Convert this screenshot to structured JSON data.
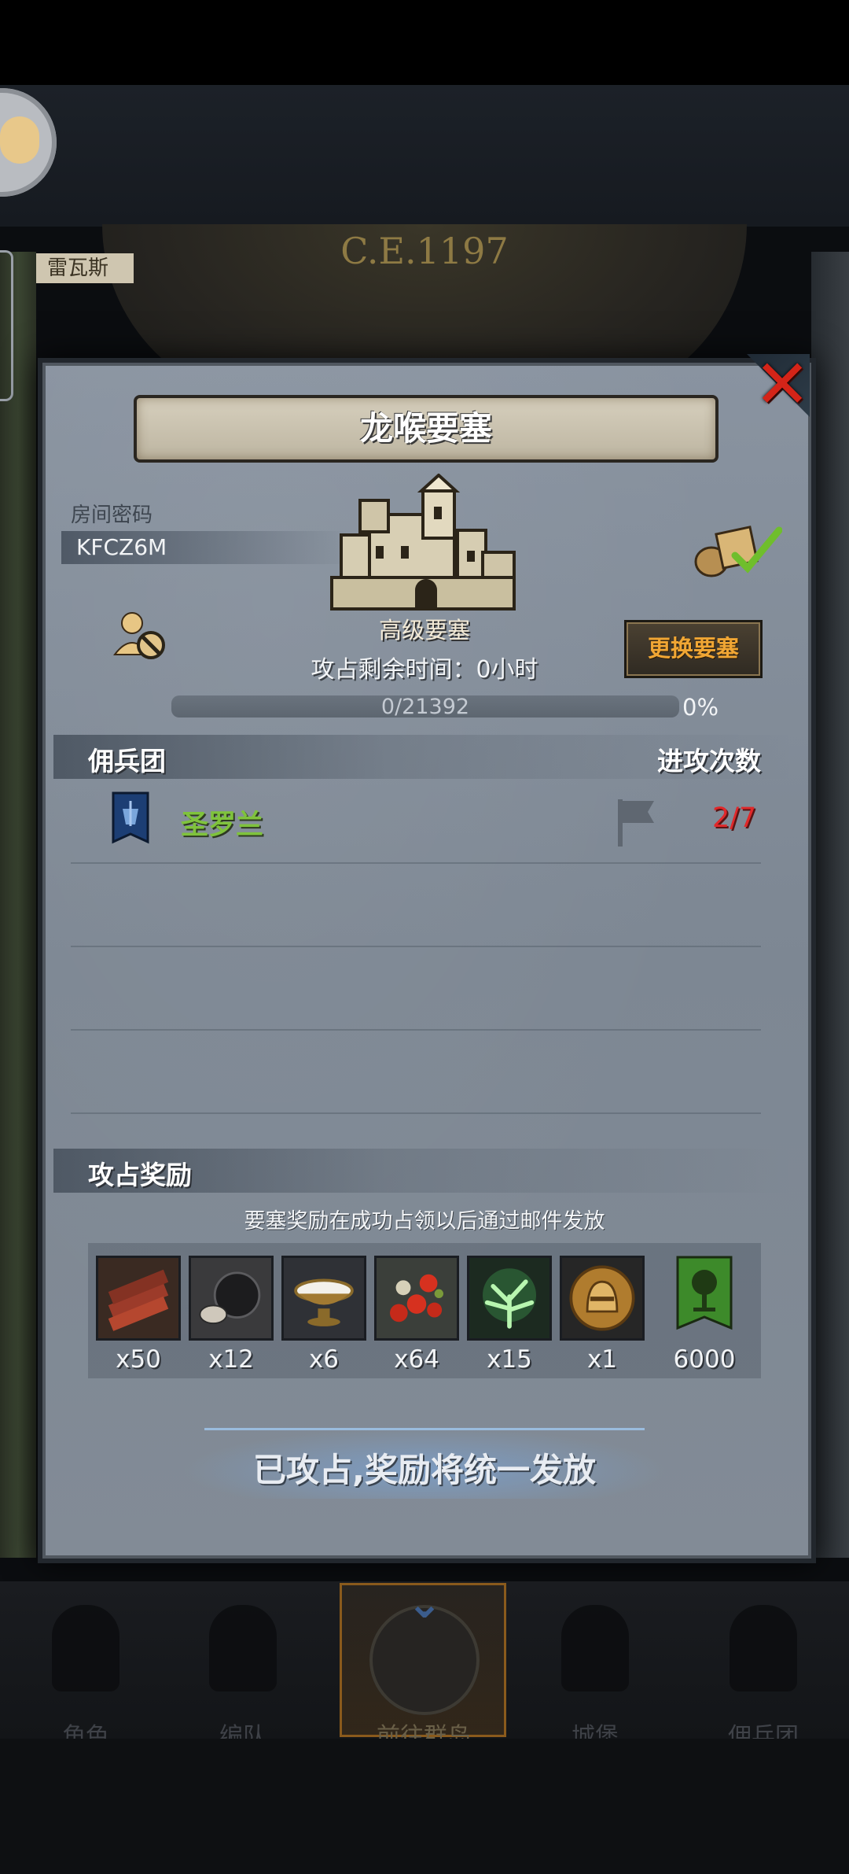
{
  "header": {
    "era": "C.E.1197",
    "map_location_tag": "雷瓦斯"
  },
  "dialog": {
    "title": "龙喉要塞",
    "room_code_label": "房间密码",
    "room_code_value": "KFCZ6M",
    "fortress_grade": "高级要塞",
    "change_button": "更换要塞",
    "remaining_time": "攻占剩余时间：0小时",
    "progress": {
      "current": 0,
      "total": 21392,
      "text": "0/21392",
      "percent": "0%"
    },
    "mercenary_section": {
      "title": "佣兵团",
      "column_right": "进攻次数",
      "rows": [
        {
          "name": "圣罗兰",
          "attacks": "2/7"
        }
      ]
    },
    "reward_section": {
      "title": "攻占奖励",
      "note": "要塞奖励在成功占领以后通过邮件发放",
      "items": [
        {
          "icon": "wood-planks-icon",
          "qty": "x50"
        },
        {
          "icon": "truffle-icon",
          "qty": "x12"
        },
        {
          "icon": "milk-bowl-icon",
          "qty": "x6"
        },
        {
          "icon": "berries-icon",
          "qty": "x64"
        },
        {
          "icon": "glowing-tree-icon",
          "qty": "x15"
        },
        {
          "icon": "knight-medal-icon",
          "qty": "x1"
        },
        {
          "icon": "green-banner-icon",
          "qty": "6000"
        }
      ]
    },
    "status": "已攻占,奖励将统一发放"
  },
  "bottom_nav": {
    "items": [
      {
        "label": "角色",
        "icon": "knight-helmet-icon"
      },
      {
        "label": "编队",
        "icon": "team-formation-icon"
      },
      {
        "label": "前往群岛",
        "icon": "compass-map-icon",
        "active": true
      },
      {
        "label": "城堡",
        "icon": "castle-icon"
      },
      {
        "label": "佣兵团",
        "icon": "mercenary-icon"
      }
    ]
  },
  "colors": {
    "accent_gold": "#f0a634",
    "mercenary_green": "#7fc33c",
    "attack_red": "#e0282a",
    "close_red": "#d42418"
  }
}
